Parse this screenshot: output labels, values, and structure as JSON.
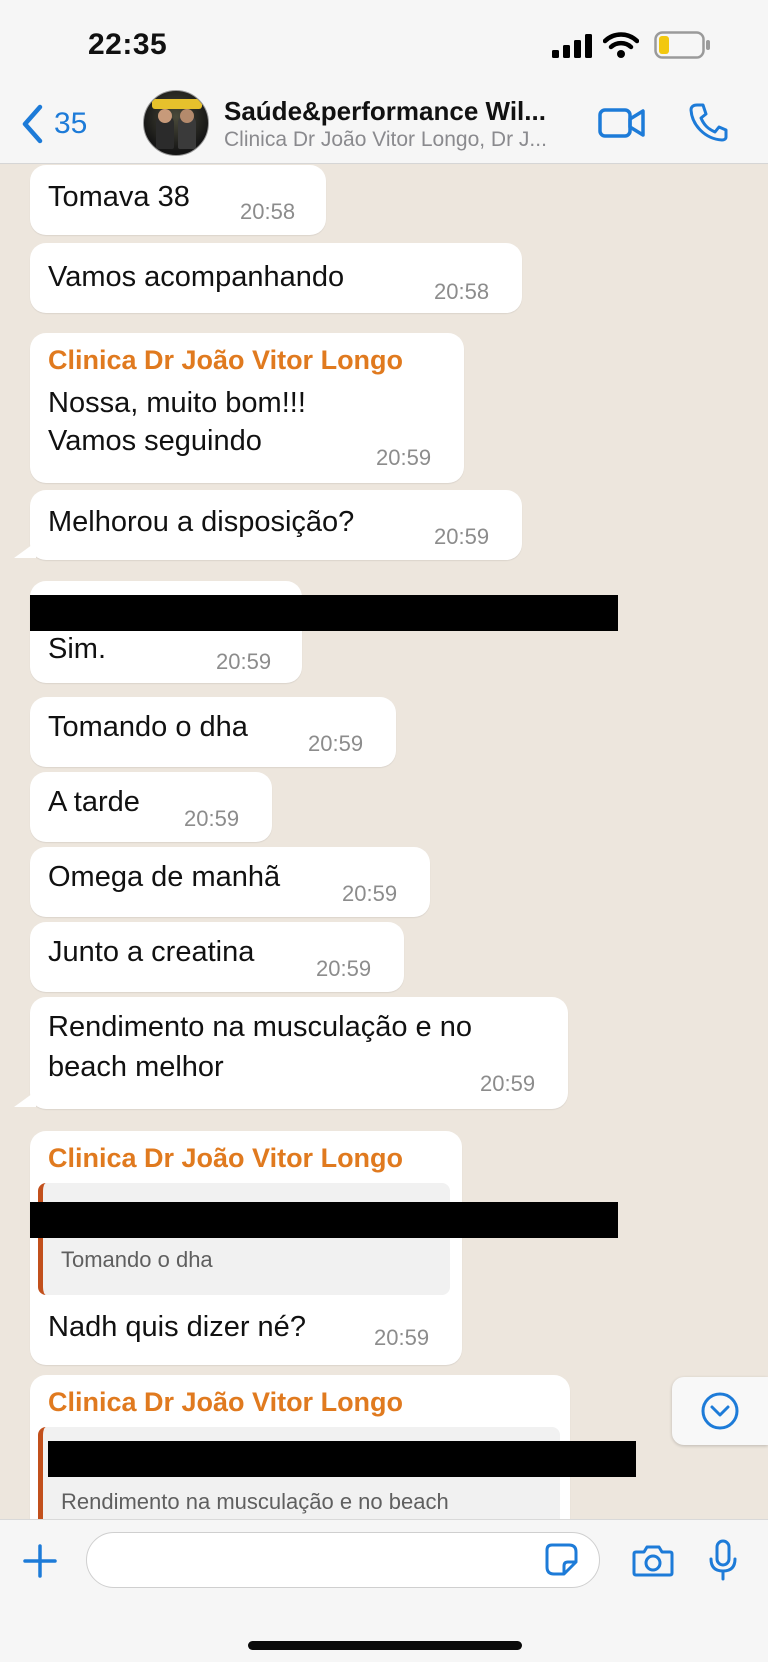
{
  "status_bar": {
    "time": "22:35"
  },
  "header": {
    "back_count": "35",
    "title": "Saúde&performance Wil...",
    "subtitle": "Clinica Dr João Vitor Longo, Dr J..."
  },
  "messages": [
    {
      "text": "Tomava 38",
      "time": "20:58"
    },
    {
      "text": "Vamos acompanhando",
      "time": "20:58"
    },
    {
      "sender": "Clinica Dr João Vitor Longo",
      "line1": "Nossa, muito bom!!!",
      "line2": "Vamos seguindo",
      "time": "20:59"
    },
    {
      "text": "Melhorou a disposição?",
      "time": "20:59"
    },
    {
      "text": "Sim.",
      "time": "20:59"
    },
    {
      "text": "Tomando o dha",
      "time": "20:59"
    },
    {
      "text": "A tarde",
      "time": "20:59"
    },
    {
      "text": "Omega de manhã",
      "time": "20:59"
    },
    {
      "text": "Junto a creatina",
      "time": "20:59"
    },
    {
      "line1": "Rendimento na musculação e no",
      "line2": "beach melhor",
      "time": "20:59"
    },
    {
      "sender": "Clinica Dr João Vitor Longo",
      "quote": "Tomando o dha",
      "text": "Nadh quis dizer né?",
      "time": "20:59"
    },
    {
      "sender": "Clinica Dr João Vitor Longo",
      "quote": "Rendimento na musculação e no beach"
    }
  ],
  "colors": {
    "sender": "#e07a1f",
    "accent": "#1d7bd8",
    "quote_bar": "#c2501c"
  },
  "icons": [
    "chevron-left-icon",
    "video-call-icon",
    "phone-icon",
    "chevron-down-icon",
    "plus-icon",
    "sticker-icon",
    "camera-icon",
    "microphone-icon",
    "signal-icon",
    "wifi-icon",
    "battery-icon"
  ]
}
